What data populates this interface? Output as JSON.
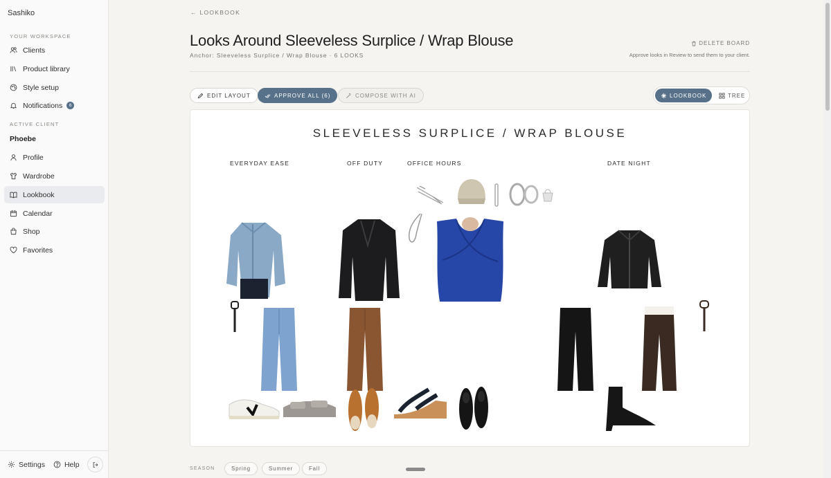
{
  "sidebar": {
    "brand": "Sashiko",
    "workspace_label": "YOUR WORKSPACE",
    "workspace_items": [
      {
        "label": "Clients",
        "icon": "users-icon"
      },
      {
        "label": "Product library",
        "icon": "library-icon"
      },
      {
        "label": "Style setup",
        "icon": "palette-icon"
      },
      {
        "label": "Notifications",
        "icon": "bell-icon",
        "badge": "6"
      }
    ],
    "client_label": "ACTIVE CLIENT",
    "client_name": "Phoebe",
    "client_items": [
      {
        "label": "Profile",
        "icon": "user-icon"
      },
      {
        "label": "Wardrobe",
        "icon": "shirt-icon"
      },
      {
        "label": "Lookbook",
        "icon": "book-icon",
        "active": true
      },
      {
        "label": "Calendar",
        "icon": "calendar-icon"
      },
      {
        "label": "Shop",
        "icon": "shopping-bag-icon"
      },
      {
        "label": "Favorites",
        "icon": "heart-icon"
      }
    ],
    "footer": {
      "settings": "Settings",
      "help": "Help"
    }
  },
  "header": {
    "back_label": "← LOOKBOOK",
    "title": "Looks Around Sleeveless Surplice / Wrap Blouse",
    "subtitle": "Anchor: Sleeveless Surplice / Wrap Blouse · 6 LOOKS",
    "delete_label": "DELETE BOARD",
    "hint": "Approve looks in Review to send them to your client."
  },
  "toolbar": {
    "edit_layout": "EDIT LAYOUT",
    "approve_all": "APPROVE ALL (6)",
    "compose_ai": "COMPOSE WITH AI",
    "view_lookbook": "LOOKBOOK",
    "view_tree": "TREE"
  },
  "board": {
    "title": "SLEEVELESS SURPLICE / WRAP BLOUSE",
    "columns": [
      "EVERYDAY EASE",
      "OFF DUTY",
      "OFFICE HOURS",
      "DATE NIGHT"
    ]
  },
  "season": {
    "label": "SEASON",
    "chips": [
      "Spring",
      "Summer",
      "Fall"
    ]
  },
  "colors": {
    "accent": "#58718a",
    "denim_jacket": "#8aa9c7",
    "blazer": "#1c1c1e",
    "blouse": "#2747a8",
    "brown_trouser": "#8a5632",
    "cap": "#cfc6b2"
  }
}
